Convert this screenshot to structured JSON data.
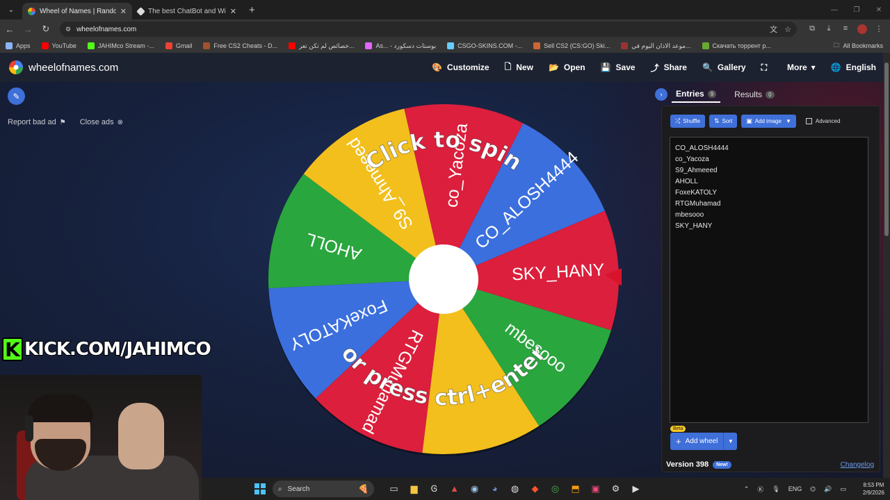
{
  "browser": {
    "tabs": [
      {
        "title": "Wheel of Names | Random nam",
        "active": true,
        "color": "#ea4335"
      },
      {
        "title": "The best ChatBot and Widgets",
        "active": false,
        "color": "#cccccc"
      }
    ],
    "url": "wheelofnames.com",
    "bookmarks": [
      {
        "label": "Apps",
        "color": "#8ab4f8"
      },
      {
        "label": "YouTube",
        "color": "#ff0000"
      },
      {
        "label": "JAHIMco Stream -...",
        "color": "#53fc18"
      },
      {
        "label": "Gmail",
        "color": "#ea4335"
      },
      {
        "label": "Free CS2 Cheats - D...",
        "color": "#a0522d"
      },
      {
        "label": "خصائص لم تكن تعر...",
        "color": "#ff0000"
      },
      {
        "label": "As... - بوستات دسكورد",
        "color": "#e066ff"
      },
      {
        "label": "CSGO-SKINS.COM -...",
        "color": "#66ccff"
      },
      {
        "label": "Sell CS2 (CS:GO) Ski...",
        "color": "#cc6633"
      },
      {
        "label": "موعد الاذان اليوم في...",
        "color": "#993333"
      },
      {
        "label": "Скачать торрент р...",
        "color": "#66aa33"
      }
    ],
    "all_bookmarks": "All Bookmarks"
  },
  "header": {
    "site_name": "wheelofnames.com",
    "nav": [
      {
        "label": "Customize",
        "icon": "palette-icon",
        "glyph": "🎨"
      },
      {
        "label": "New",
        "icon": "new-file-icon",
        "glyph": "🗋"
      },
      {
        "label": "Open",
        "icon": "folder-icon",
        "glyph": "📂"
      },
      {
        "label": "Save",
        "icon": "save-icon",
        "glyph": "💾"
      },
      {
        "label": "Share",
        "icon": "share-icon",
        "glyph": "⤴"
      },
      {
        "label": "Gallery",
        "icon": "search-icon",
        "glyph": "🔍"
      },
      {
        "label": "",
        "icon": "fullscreen-icon",
        "glyph": "⛶"
      },
      {
        "label": "More",
        "icon": "chevron-down-icon",
        "glyph": "▾"
      },
      {
        "label": "English",
        "icon": "globe-icon",
        "glyph": "🌐"
      }
    ]
  },
  "ads": {
    "report": "Report bad ad",
    "close": "Close ads"
  },
  "wheel": {
    "top_text": "Click to spin",
    "bottom_text": "or press ctrl+enter",
    "colors": {
      "red": "#db1f3c",
      "blue": "#3b6fdd",
      "green": "#2aa63e",
      "yellow": "#f2bf1d"
    },
    "segments": [
      {
        "label": "SKY_HANY",
        "color": "#db1f3c"
      },
      {
        "label": "mbesooo",
        "color": "#2aa63e"
      },
      {
        "label": "",
        "color": "#f2bf1d"
      },
      {
        "label": "RTGMuhamad",
        "color": "#db1f3c"
      },
      {
        "label": "FoxeKATOLY",
        "color": "#3b6fdd"
      },
      {
        "label": "AHOLL",
        "color": "#2aa63e"
      },
      {
        "label": "S9_Ahmeeed",
        "color": "#f2bf1d"
      },
      {
        "label": "co_Yacoza",
        "color": "#db1f3c"
      },
      {
        "label": "CO_ALOSH4444",
        "color": "#3b6fdd"
      }
    ]
  },
  "panel": {
    "tab_entries": "Entries",
    "entries_count": "9",
    "tab_results": "Results",
    "results_count": "0",
    "shuffle": "Shuffle",
    "sort": "Sort",
    "add_image": "Add image",
    "advanced": "Advanced",
    "entries": [
      "CO_ALOSH4444",
      "co_Yacoza",
      "S9_Ahmeeed",
      "AHOLL",
      "FoxeKATOLY",
      "RTGMuhamad",
      "mbesooo",
      "SKY_HANY"
    ],
    "beta": "Beta",
    "add_wheel": "Add wheel",
    "version": "Version 398",
    "new_badge": "New!",
    "changelog": "Changelog"
  },
  "overlay": {
    "kick_text": "KICK.COM/JAHIMCO",
    "kick_letter": "K"
  },
  "taskbar": {
    "search": "Search",
    "lang": "ENG",
    "time": "8:53 PM",
    "date": "2/9/2026"
  }
}
